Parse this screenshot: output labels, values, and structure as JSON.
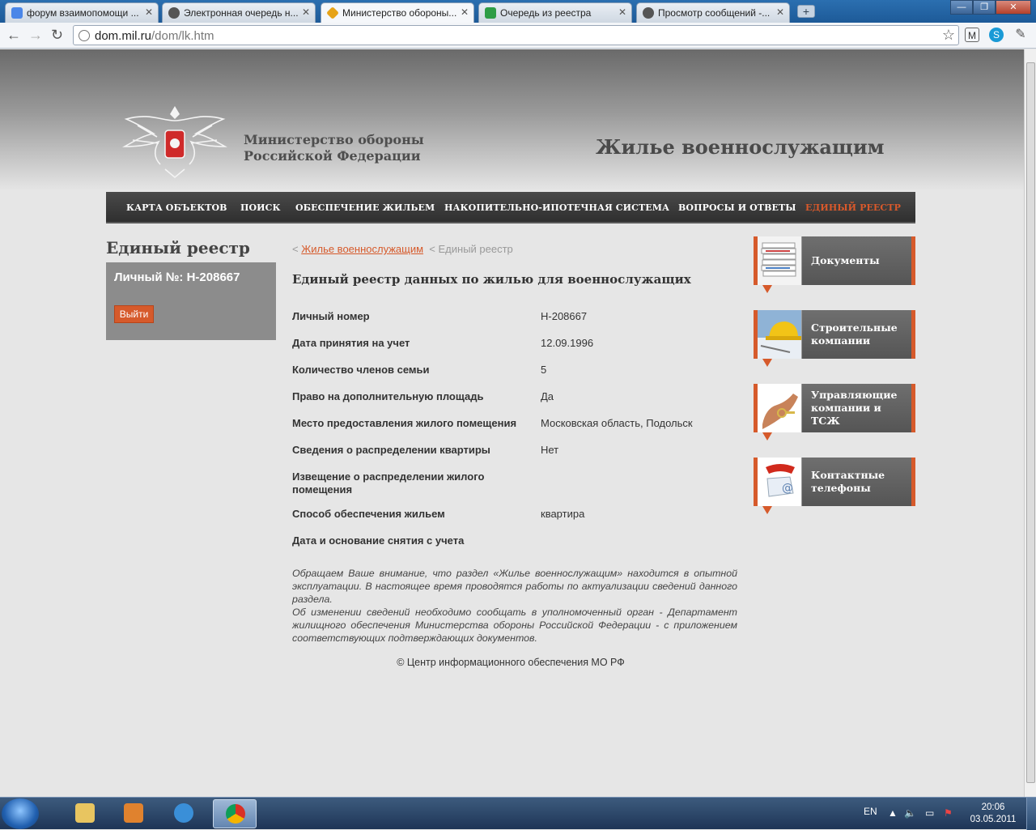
{
  "browser": {
    "tabs": [
      {
        "title": "форум взаимопомощи ...",
        "icon": "google-icon",
        "color": "#4a86e8"
      },
      {
        "title": "Электронная очередь н...",
        "icon": "hat-icon",
        "color": "#555555"
      },
      {
        "title": "Министерство обороны...",
        "icon": "diamond-icon",
        "color": "#e6a317",
        "active": true
      },
      {
        "title": "Очередь из реестра",
        "icon": "sheet-icon",
        "color": "#2e9d46"
      },
      {
        "title": "Просмотр сообщений -...",
        "icon": "hat-icon",
        "color": "#555555"
      }
    ],
    "url_domain": "dom.mil.ru",
    "url_path": "/dom/lk.htm"
  },
  "site": {
    "ministry_line1": "Министерство обороны",
    "ministry_line2": "Российской Федерации",
    "title": "Жилье военнослужащим"
  },
  "nav": [
    "КАРТА ОБЪЕКТОВ",
    "ПОИСК",
    "ОБЕСПЕЧЕНИЕ ЖИЛЬЕМ",
    "НАКОПИТЕЛЬНО-ИПОТЕЧНАЯ СИСТЕМА",
    "ВОПРОСЫ И ОТВЕТЫ",
    "ЕДИНЫЙ РЕЕСТР"
  ],
  "left": {
    "title": "Единый реестр",
    "personal_number": "Личный №: Н-208667",
    "logout": "Выйти"
  },
  "breadcrumbs": {
    "link": "Жилье военнослужащим",
    "current": "Единый реестр",
    "separator": "<"
  },
  "content": {
    "title": "Единый реестр данных по жилью для военнослужащих",
    "rows": [
      {
        "label": "Личный номер",
        "value": "Н-208667"
      },
      {
        "label": "Дата принятия на учет",
        "value": "12.09.1996"
      },
      {
        "label": "Количество членов семьи",
        "value": "5"
      },
      {
        "label": "Право на дополнительную площадь",
        "value": "Да"
      },
      {
        "label": "Место предоставления жилого помещения",
        "value": "Московская область, Подольск"
      },
      {
        "label": "Сведения о распределении квартиры",
        "value": "Нет"
      },
      {
        "label": "Извещение о распределении жилого помещения",
        "value": ""
      },
      {
        "label": "Способ обеспечения жильем",
        "value": "квартира"
      },
      {
        "label": "Дата и основание снятия с учета",
        "value": ""
      }
    ],
    "notice_p1": "Обращаем Ваше внимание, что раздел «Жилье военнослужащим» находится в опытной эксплуатации. В настоящее время проводятся работы по актуализации сведений данного раздела.",
    "notice_p2": "Об изменении сведений необходимо сообщать в уполномоченный орган - Департамент жилищного обеспечения Министерства обороны Российской Федерации - с приложением соответствующих подтверждающих документов.",
    "copyright": "© Центр информационного обеспечения МО РФ"
  },
  "tiles": [
    {
      "label": "Документы"
    },
    {
      "label": "Строительные компании"
    },
    {
      "label": "Управляющие компании и ТСЖ"
    },
    {
      "label": "Контактные телефоны"
    }
  ],
  "taskbar": {
    "lang": "EN",
    "time": "20:06",
    "date": "03.05.2011"
  },
  "colors": {
    "accent": "#d65a2b",
    "nav_bg": "#3a3a3a"
  }
}
